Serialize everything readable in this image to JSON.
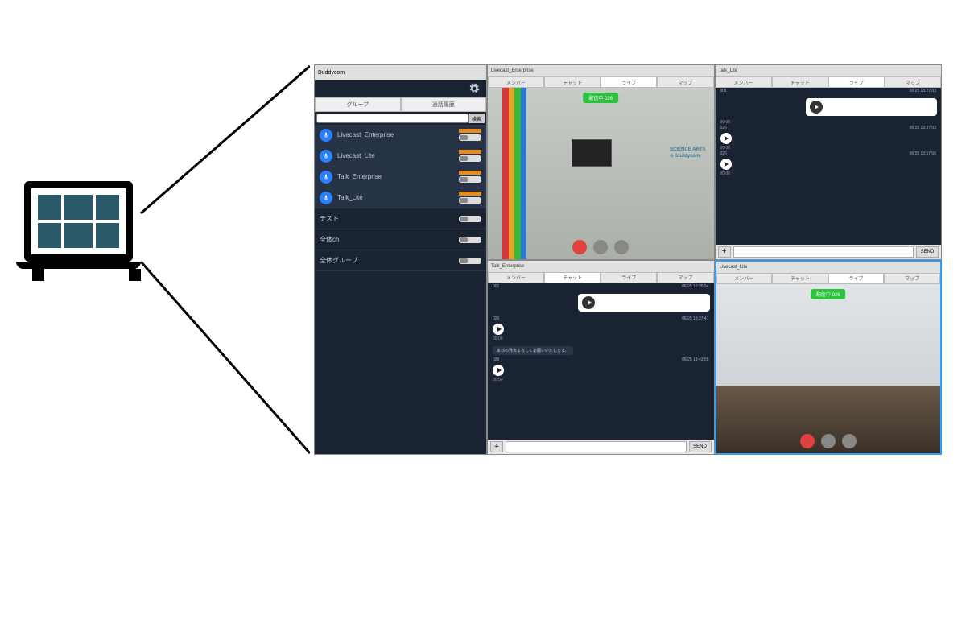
{
  "app_title": "Buddycom",
  "main_tabs": {
    "left": "グループ",
    "right": "通話履歴"
  },
  "search_btn": "検索",
  "groups": [
    {
      "label": "Livecast_Enterprise",
      "mic": true,
      "active": true
    },
    {
      "label": "Livecast_Lite",
      "mic": true,
      "active": true
    },
    {
      "label": "Talk_Enterprise",
      "mic": true,
      "active": true
    },
    {
      "label": "Talk_Lite",
      "mic": true,
      "active": true
    },
    {
      "label": "テスト",
      "mic": false,
      "active": false
    },
    {
      "label": "全体ch",
      "mic": false,
      "active": false
    },
    {
      "label": "全体グループ",
      "mic": false,
      "active": false
    }
  ],
  "panel_tabs": {
    "member": "メンバー",
    "chat": "チャット",
    "live": "ライブ",
    "map": "マップ"
  },
  "status_badge": "配信中 026",
  "send_btn": "SEND",
  "panels": {
    "tl": {
      "title": "Livecast_Enterprise",
      "logo_line1": "SCIENCE ARTS",
      "logo_line2": "☆ buddycom"
    },
    "tr": {
      "title": "Talk_Lite",
      "msgs": [
        {
          "id": "001",
          "ts": "06/25 13:27:03",
          "dur": "00:00",
          "card": true
        },
        {
          "id": "026",
          "ts": "06/25 13:37:03",
          "dur": "00:00",
          "card": false
        },
        {
          "id": "026",
          "ts": "06/25 13:57:56",
          "dur": "00:00",
          "card": false
        }
      ]
    },
    "bl": {
      "title": "Talk_Enterprise",
      "msgs": [
        {
          "id": "001",
          "ts": "06/25 13:35:54",
          "dur": "",
          "card": true
        },
        {
          "id": "026",
          "ts": "06/25 13:37:41",
          "dur": "00:00",
          "card": false
        },
        {
          "text": "本日の発表よろしくお願いいたします。"
        },
        {
          "id": "026",
          "ts": "06/25 13:43:55",
          "dur": "00:00",
          "card": false
        }
      ]
    },
    "br": {
      "title": "Livecast_Lite"
    }
  }
}
